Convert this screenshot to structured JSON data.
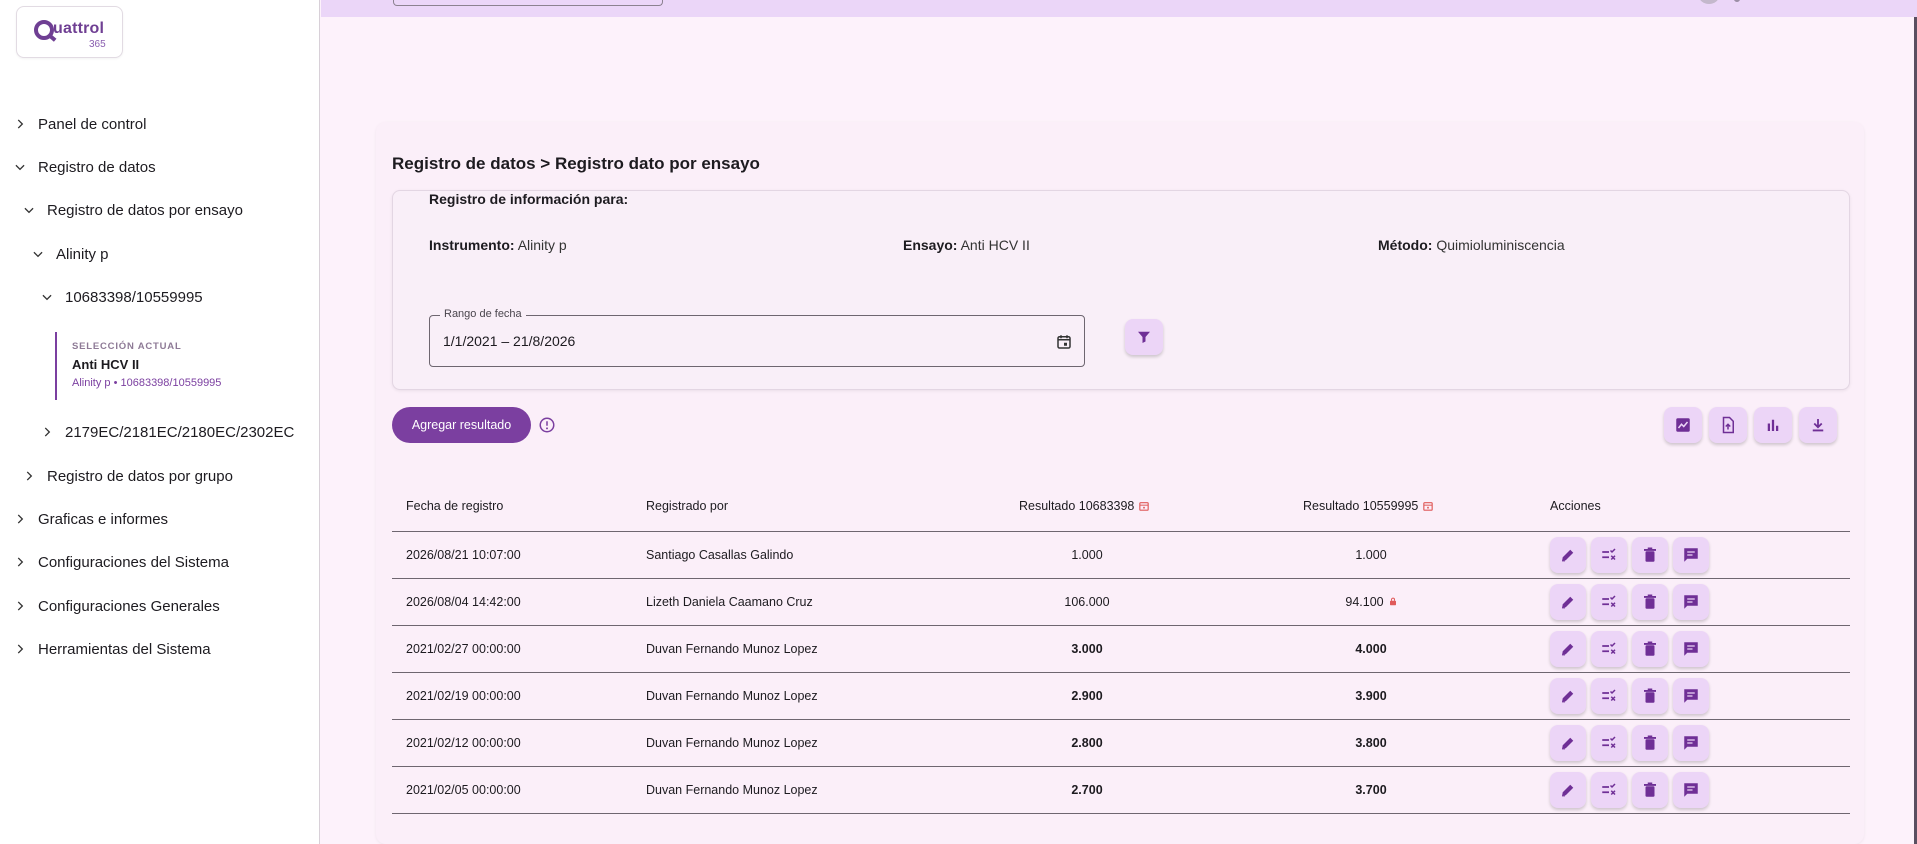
{
  "sidebar": {
    "logo": {
      "name": "uattrol",
      "sub": "365"
    },
    "items": [
      {
        "label": "Panel de control"
      },
      {
        "label": "Registro de datos"
      },
      {
        "label": "Registro de datos por ensayo"
      },
      {
        "label": "Alinity p"
      },
      {
        "label": "10683398/10559995"
      },
      {
        "label": "2179EC/2181EC/2180EC/2302EC"
      },
      {
        "label": "Registro de datos por grupo"
      },
      {
        "label": "Graficas e informes"
      },
      {
        "label": "Configuraciones del Sistema"
      },
      {
        "label": "Configuraciones Generales"
      },
      {
        "label": "Herramientas del Sistema"
      }
    ],
    "current_selection": {
      "label": "SELECCIÓN ACTUAL",
      "title": "Anti HCV II",
      "subtitle": "Alinity p • 10683398/10559995"
    }
  },
  "main": {
    "breadcrumb": "Registro de datos > Registro dato por ensayo",
    "info": {
      "title": "Registro de información para:",
      "instrument_label": "Instrumento:",
      "instrument_value": "Alinity p",
      "assay_label": "Ensayo:",
      "assay_value": "Anti HCV II",
      "method_label": "Método:",
      "method_value": "Quimioluminiscencia"
    },
    "date_range": {
      "label": "Rango de fecha",
      "value": "1/1/2021  – 21/8/2026"
    },
    "add_button": "Agregar resultado",
    "table": {
      "headers": [
        "Fecha de registro",
        "Registrado por",
        "Resultado 10683398",
        "Resultado 10559995",
        "Acciones"
      ],
      "rows": [
        {
          "date": "2026/08/21 10:07:00",
          "user": "Santiago Casallas Galindo",
          "r1": "1.000",
          "r2": "1.000",
          "bold": false,
          "flag": false
        },
        {
          "date": "2026/08/04 14:42:00",
          "user": "Lizeth Daniela Caamano Cruz",
          "r1": "106.000",
          "r2": "94.100",
          "bold": false,
          "flag": true
        },
        {
          "date": "2021/02/27 00:00:00",
          "user": "Duvan Fernando Munoz Lopez",
          "r1": "3.000",
          "r2": "4.000",
          "bold": true,
          "flag": false
        },
        {
          "date": "2021/02/19 00:00:00",
          "user": "Duvan Fernando Munoz Lopez",
          "r1": "2.900",
          "r2": "3.900",
          "bold": true,
          "flag": false
        },
        {
          "date": "2021/02/12 00:00:00",
          "user": "Duvan Fernando Munoz Lopez",
          "r1": "2.800",
          "r2": "3.800",
          "bold": true,
          "flag": false
        },
        {
          "date": "2021/02/05 00:00:00",
          "user": "Duvan Fernando Munoz Lopez",
          "r1": "2.700",
          "r2": "3.700",
          "bold": true,
          "flag": false
        }
      ]
    }
  },
  "colors": {
    "accent": "#7b3fa0",
    "accent_light": "#ecd5f7",
    "background": "#fdf2fb",
    "topbar": "#ebd6f8",
    "alert": "#e05a5a"
  },
  "icons": [
    "chevron-right-icon",
    "chevron-down-icon",
    "calendar-icon",
    "filter-icon",
    "info-icon",
    "chart-line-icon",
    "upload-file-icon",
    "bar-chart-icon",
    "download-icon",
    "edit-icon",
    "rule-icon",
    "delete-icon",
    "comment-icon",
    "lock-icon"
  ]
}
